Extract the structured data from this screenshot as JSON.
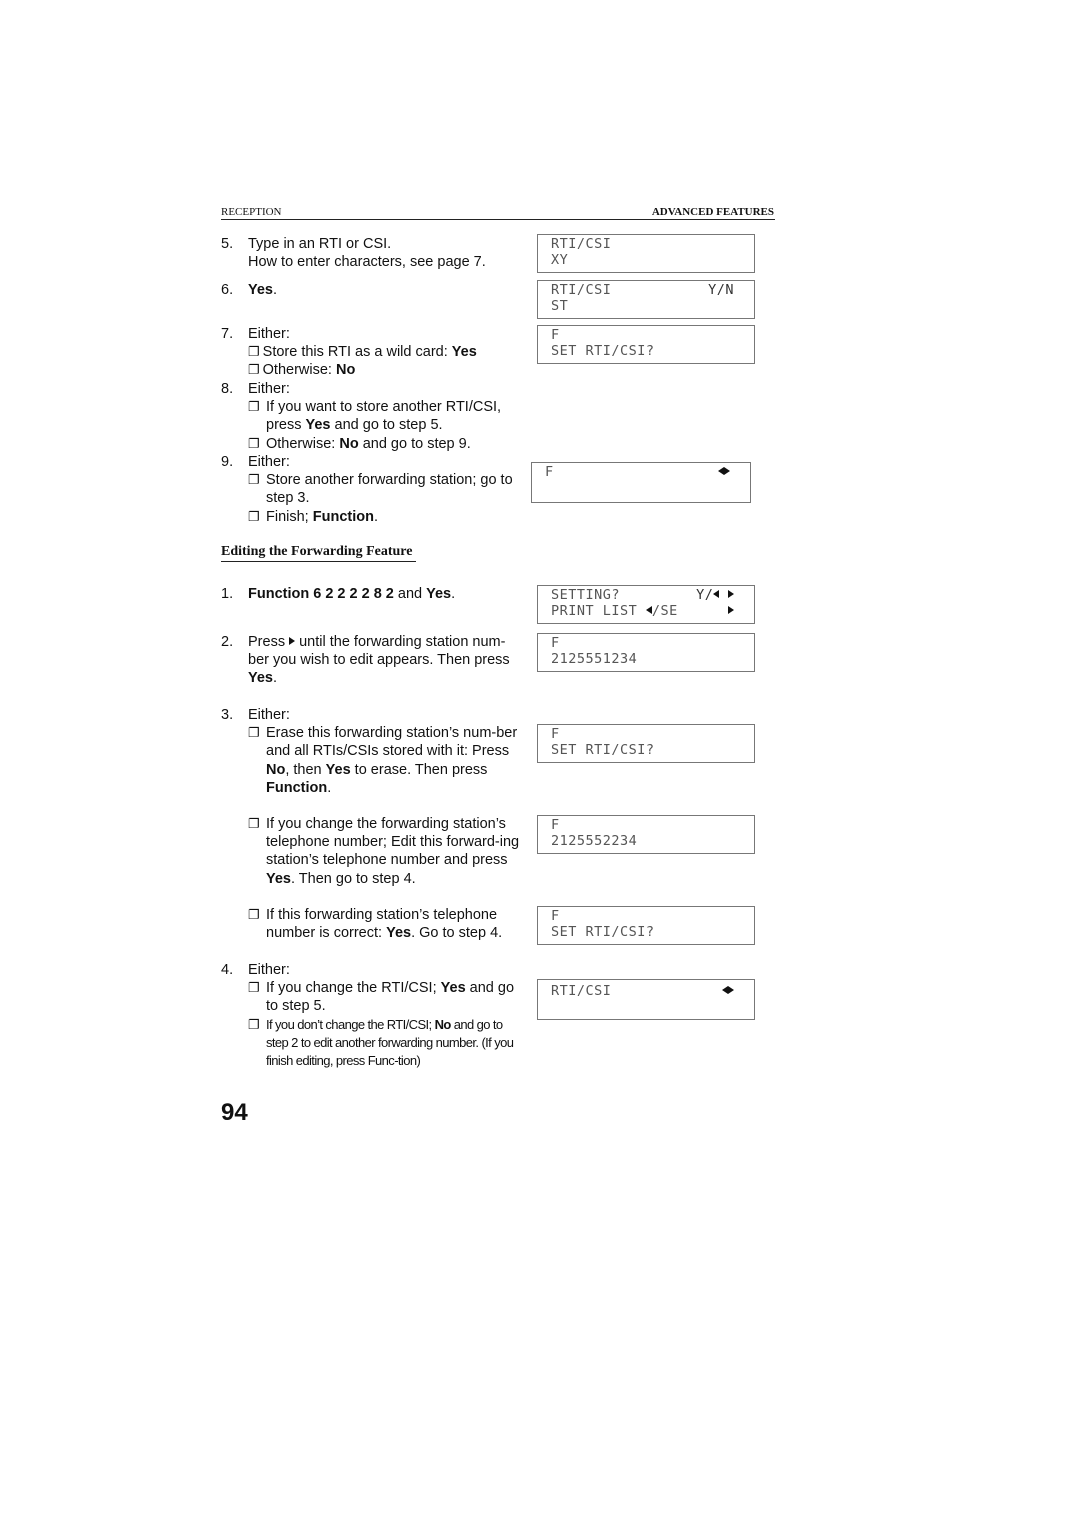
{
  "header": {
    "left": "RECEPTION",
    "right": "ADVANCED FEATURES"
  },
  "section1": {
    "steps": [
      {
        "num": "5.",
        "lines": [
          "Type in an RTI or CSI.",
          "How to enter characters, see page 7."
        ]
      },
      {
        "num": "6.",
        "bold": "Yes",
        "suffix": "."
      },
      {
        "num": "7.",
        "lead": "Either:",
        "options": [
          {
            "pre": "Store this RTI as a wild card: ",
            "bold": "Yes",
            "post": ""
          },
          {
            "pre": "Otherwise: ",
            "bold": "No",
            "post": ""
          }
        ]
      },
      {
        "num": "8.",
        "lead": "Either:",
        "options": [
          {
            "pre": "If you want to store another RTI/CSI, press ",
            "bold": "Yes",
            "post": " and go to step 5."
          },
          {
            "pre": "Otherwise: ",
            "bold": "No",
            "post": " and go to step 9."
          }
        ]
      },
      {
        "num": "9.",
        "lead": "Either:",
        "options": [
          {
            "pre": "Store another forwarding station; go to step 3.",
            "bold": "",
            "post": ""
          },
          {
            "pre": "Finish; ",
            "bold": "Function",
            "post": "."
          }
        ]
      }
    ]
  },
  "section2": {
    "title": "Editing the Forwarding Feature",
    "step1": {
      "num": "1.",
      "bold1": "Function 6 2 2 2 2 8 2",
      "mid": " and ",
      "bold2": "Yes",
      "post": "."
    },
    "step2": {
      "num": "2.",
      "pre": "Press ",
      "mid": " until the forwarding station num-ber you wish to edit appears. Then press ",
      "bold": "Yes",
      "post": "."
    },
    "step3": {
      "num": "3.",
      "lead": "Either:",
      "opt1": {
        "pre": "Erase this forwarding station’s num-ber and all RTIs/CSIs stored with it: Press ",
        "b1": "No",
        "m1": ", then ",
        "b2": "Yes",
        "m2": " to erase. Then press ",
        "b3": "Function",
        "post": "."
      },
      "opt2": {
        "pre": "If you change the forwarding station’s telephone number; Edit this forward-ing station’s telephone number and press ",
        "bold": "Yes",
        "post": ". Then go to step 4."
      },
      "opt3": {
        "pre": "If this forwarding station’s telephone number is correct: ",
        "bold": "Yes",
        "post": ". Go to step 4."
      }
    },
    "step4": {
      "num": "4.",
      "lead": "Either:",
      "opt1": {
        "pre": "If you change the RTI/CSI; ",
        "bold": "Yes",
        "post": " and go to step 5."
      },
      "opt2": {
        "pre": "If you don’t change the RTI/CSI; ",
        "bold": "No",
        "post": " and go to step 2 to edit another forwarding number. (If you finish editing, press Func-tion)"
      }
    }
  },
  "displays": [
    {
      "line1": "RTI/CSI",
      "line2": "XY",
      "right1": ""
    },
    {
      "line1": "RTI/CSI",
      "line2": "ST",
      "right1": "Y/N"
    },
    {
      "line1": "F",
      "line2": "SET RTI/CSI?",
      "right1": ""
    },
    {
      "line1": "F",
      "line2": "",
      "right1": "arrows"
    },
    {
      "line1": "SETTING?",
      "line2": "PRINT LIST",
      "line2b": "/SE",
      "right1": "Y/"
    },
    {
      "line1": "F",
      "line2": "2125551234"
    },
    {
      "line1": "F",
      "line2": "SET RTI/CSI?"
    },
    {
      "line1": "F",
      "line2": "2125552234"
    },
    {
      "line1": "F",
      "line2": "SET RTI/CSI?"
    },
    {
      "line1": "RTI/CSI",
      "line2": ""
    }
  ],
  "checkbox_glyph": "❐",
  "page_number": "94"
}
